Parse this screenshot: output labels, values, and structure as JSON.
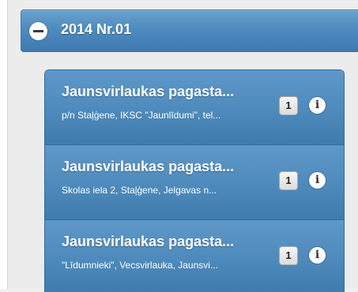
{
  "header": {
    "title": "2014 Nr.01"
  },
  "items": [
    {
      "title": "Jaunsvirlaukas pagasta...",
      "subtitle": "p/n Staļģene, IKSC \"Jaunlīdumi\", tel...",
      "count": "1"
    },
    {
      "title": "Jaunsvirlaukas pagasta...",
      "subtitle": "Skolas iela 2, Staļģene, Jelgavas n...",
      "count": "1"
    },
    {
      "title": "Jaunsvirlaukas pagasta...",
      "subtitle": "\"Līdumnieki\", Vecsvirlauka, Jaunsvi...",
      "count": "1"
    }
  ],
  "icons": {
    "collapse": "minus-circle-icon",
    "info": "info-icon"
  },
  "colors": {
    "accent": "#4e8bbf",
    "background": "#ececec"
  }
}
